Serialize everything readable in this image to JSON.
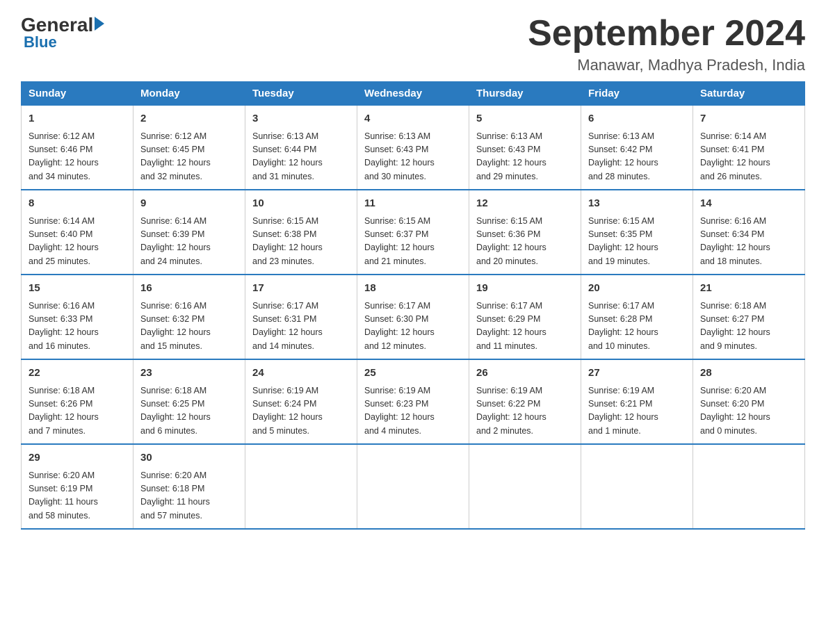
{
  "logo": {
    "general": "General",
    "blue": "Blue",
    "arrow": "▶"
  },
  "title": "September 2024",
  "subtitle": "Manawar, Madhya Pradesh, India",
  "weekdays": [
    "Sunday",
    "Monday",
    "Tuesday",
    "Wednesday",
    "Thursday",
    "Friday",
    "Saturday"
  ],
  "weeks": [
    [
      {
        "day": "1",
        "sunrise": "6:12 AM",
        "sunset": "6:46 PM",
        "daylight": "12 hours and 34 minutes."
      },
      {
        "day": "2",
        "sunrise": "6:12 AM",
        "sunset": "6:45 PM",
        "daylight": "12 hours and 32 minutes."
      },
      {
        "day": "3",
        "sunrise": "6:13 AM",
        "sunset": "6:44 PM",
        "daylight": "12 hours and 31 minutes."
      },
      {
        "day": "4",
        "sunrise": "6:13 AM",
        "sunset": "6:43 PM",
        "daylight": "12 hours and 30 minutes."
      },
      {
        "day": "5",
        "sunrise": "6:13 AM",
        "sunset": "6:43 PM",
        "daylight": "12 hours and 29 minutes."
      },
      {
        "day": "6",
        "sunrise": "6:13 AM",
        "sunset": "6:42 PM",
        "daylight": "12 hours and 28 minutes."
      },
      {
        "day": "7",
        "sunrise": "6:14 AM",
        "sunset": "6:41 PM",
        "daylight": "12 hours and 26 minutes."
      }
    ],
    [
      {
        "day": "8",
        "sunrise": "6:14 AM",
        "sunset": "6:40 PM",
        "daylight": "12 hours and 25 minutes."
      },
      {
        "day": "9",
        "sunrise": "6:14 AM",
        "sunset": "6:39 PM",
        "daylight": "12 hours and 24 minutes."
      },
      {
        "day": "10",
        "sunrise": "6:15 AM",
        "sunset": "6:38 PM",
        "daylight": "12 hours and 23 minutes."
      },
      {
        "day": "11",
        "sunrise": "6:15 AM",
        "sunset": "6:37 PM",
        "daylight": "12 hours and 21 minutes."
      },
      {
        "day": "12",
        "sunrise": "6:15 AM",
        "sunset": "6:36 PM",
        "daylight": "12 hours and 20 minutes."
      },
      {
        "day": "13",
        "sunrise": "6:15 AM",
        "sunset": "6:35 PM",
        "daylight": "12 hours and 19 minutes."
      },
      {
        "day": "14",
        "sunrise": "6:16 AM",
        "sunset": "6:34 PM",
        "daylight": "12 hours and 18 minutes."
      }
    ],
    [
      {
        "day": "15",
        "sunrise": "6:16 AM",
        "sunset": "6:33 PM",
        "daylight": "12 hours and 16 minutes."
      },
      {
        "day": "16",
        "sunrise": "6:16 AM",
        "sunset": "6:32 PM",
        "daylight": "12 hours and 15 minutes."
      },
      {
        "day": "17",
        "sunrise": "6:17 AM",
        "sunset": "6:31 PM",
        "daylight": "12 hours and 14 minutes."
      },
      {
        "day": "18",
        "sunrise": "6:17 AM",
        "sunset": "6:30 PM",
        "daylight": "12 hours and 12 minutes."
      },
      {
        "day": "19",
        "sunrise": "6:17 AM",
        "sunset": "6:29 PM",
        "daylight": "12 hours and 11 minutes."
      },
      {
        "day": "20",
        "sunrise": "6:17 AM",
        "sunset": "6:28 PM",
        "daylight": "12 hours and 10 minutes."
      },
      {
        "day": "21",
        "sunrise": "6:18 AM",
        "sunset": "6:27 PM",
        "daylight": "12 hours and 9 minutes."
      }
    ],
    [
      {
        "day": "22",
        "sunrise": "6:18 AM",
        "sunset": "6:26 PM",
        "daylight": "12 hours and 7 minutes."
      },
      {
        "day": "23",
        "sunrise": "6:18 AM",
        "sunset": "6:25 PM",
        "daylight": "12 hours and 6 minutes."
      },
      {
        "day": "24",
        "sunrise": "6:19 AM",
        "sunset": "6:24 PM",
        "daylight": "12 hours and 5 minutes."
      },
      {
        "day": "25",
        "sunrise": "6:19 AM",
        "sunset": "6:23 PM",
        "daylight": "12 hours and 4 minutes."
      },
      {
        "day": "26",
        "sunrise": "6:19 AM",
        "sunset": "6:22 PM",
        "daylight": "12 hours and 2 minutes."
      },
      {
        "day": "27",
        "sunrise": "6:19 AM",
        "sunset": "6:21 PM",
        "daylight": "12 hours and 1 minute."
      },
      {
        "day": "28",
        "sunrise": "6:20 AM",
        "sunset": "6:20 PM",
        "daylight": "12 hours and 0 minutes."
      }
    ],
    [
      {
        "day": "29",
        "sunrise": "6:20 AM",
        "sunset": "6:19 PM",
        "daylight": "11 hours and 58 minutes."
      },
      {
        "day": "30",
        "sunrise": "6:20 AM",
        "sunset": "6:18 PM",
        "daylight": "11 hours and 57 minutes."
      },
      null,
      null,
      null,
      null,
      null
    ]
  ],
  "labels": {
    "sunrise": "Sunrise:",
    "sunset": "Sunset:",
    "daylight": "Daylight:"
  }
}
